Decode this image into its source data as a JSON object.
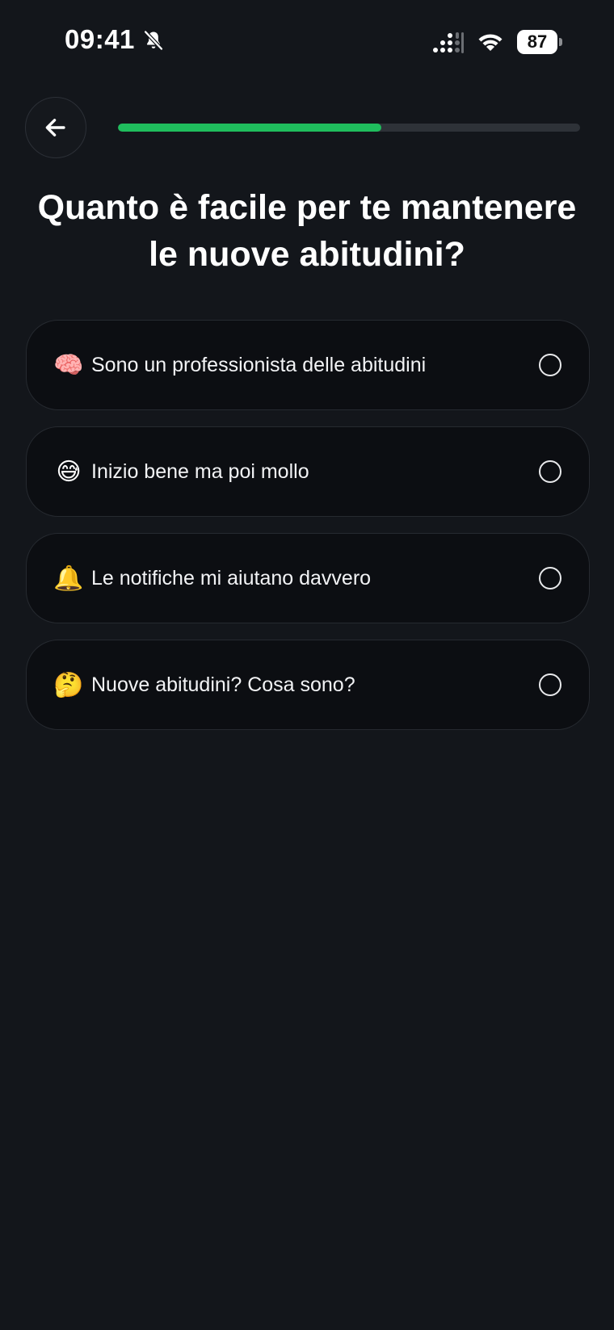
{
  "status_bar": {
    "time": "09:41",
    "battery_level": "87",
    "icons": [
      "bell-off-icon",
      "signal-icon",
      "wifi-icon",
      "battery-icon"
    ]
  },
  "nav": {
    "back_icon": "arrow-left-icon"
  },
  "progress": {
    "fraction": 0.57,
    "fill_color": "#1fbd5d",
    "track_color": "#2e3238"
  },
  "question": {
    "title": "Quanto è facile per te mantenere le nuove abitudini?"
  },
  "options": [
    {
      "emoji": "🧠",
      "label": "Sono un professionista delle abitudini",
      "selected": false
    },
    {
      "emoji": "😅",
      "label": "Inizio bene ma poi mollo",
      "selected": false
    },
    {
      "emoji": "🔔",
      "label": "Le notifiche mi aiutano davvero",
      "selected": false
    },
    {
      "emoji": "🤔",
      "label": "Nuove abitudini? Cosa sono?",
      "selected": false
    }
  ],
  "colors": {
    "background": "#13161b",
    "card": "#0c0e12",
    "card_border": "#262a30",
    "accent": "#1fbd5d"
  }
}
